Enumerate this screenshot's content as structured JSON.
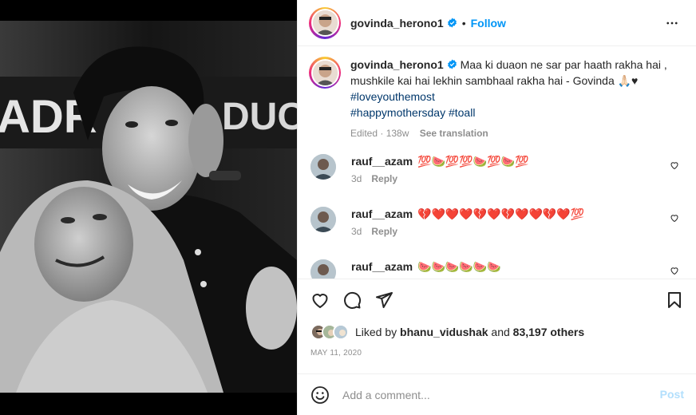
{
  "header": {
    "username": "govinda_herono1",
    "separator": "•",
    "follow_label": "Follow",
    "more_icon": "more-horizontal-icon",
    "verified_icon": "verified-badge-icon"
  },
  "caption": {
    "username": "govinda_herono1",
    "text": "Maa ki duaon ne sar par haath rakha hai , mushkile kai hai lekhin sambhaal rakha hai - Govinda",
    "emojis": "🙏🏻♥",
    "hashtags": [
      "#loveyouthemost",
      "#happymothersday",
      "#toall"
    ],
    "edited": "Edited · 138w",
    "see_translation": "See translation"
  },
  "comments": [
    {
      "username": "rauf__azam",
      "text": "💯🍉💯💯🍉💯🍉💯",
      "time": "3d",
      "reply_label": "Reply"
    },
    {
      "username": "rauf__azam",
      "text": "💔❤️❤️❤️💔❤️💔❤️❤️💔❤️💯",
      "time": "3d",
      "reply_label": "Reply"
    },
    {
      "username": "rauf__azam",
      "text": "🍉🍉🍉🍉🍉🍉",
      "time": "",
      "reply_label": ""
    }
  ],
  "actions": {
    "like_icon": "heart-icon",
    "comment_icon": "comment-icon",
    "share_icon": "paper-plane-icon",
    "save_icon": "bookmark-icon"
  },
  "likes": {
    "prefix": "Liked by",
    "user": "bhanu_vidushak",
    "middle": "and",
    "count": "83,197 others"
  },
  "date": "MAY 11, 2020",
  "add_comment": {
    "placeholder": "Add a comment...",
    "post_label": "Post",
    "emoji_icon": "smiley-icon"
  },
  "colors": {
    "accent": "#0095f6",
    "post_disabled": "#b2dffc",
    "secondary_text": "#8e8e8e",
    "hashtag": "#00376b"
  }
}
